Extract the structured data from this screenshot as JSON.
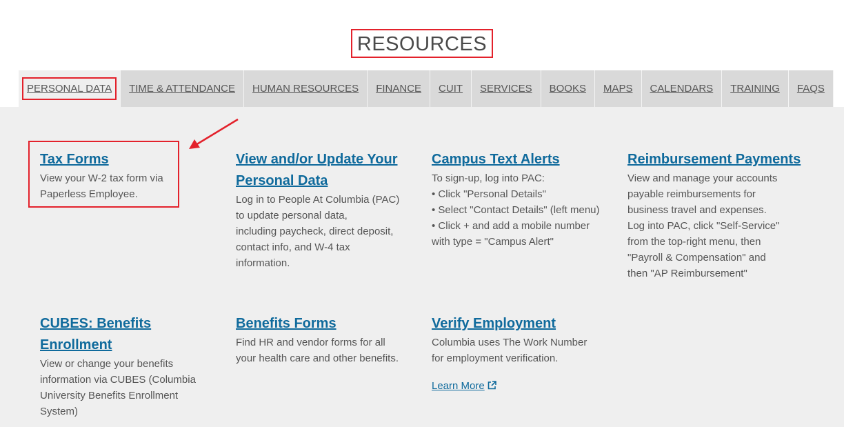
{
  "header": {
    "title": "RESOURCES"
  },
  "tabs": [
    {
      "label": "PERSONAL DATA",
      "active": true
    },
    {
      "label": "TIME & ATTENDANCE"
    },
    {
      "label": "HUMAN RESOURCES"
    },
    {
      "label": "FINANCE"
    },
    {
      "label": "CUIT"
    },
    {
      "label": "SERVICES"
    },
    {
      "label": "BOOKS"
    },
    {
      "label": "MAPS"
    },
    {
      "label": "CALENDARS"
    },
    {
      "label": "TRAINING"
    },
    {
      "label": "FAQS"
    }
  ],
  "cards": [
    {
      "title": "Tax Forms",
      "lines": [
        "View your W-2 tax form via",
        "Paperless Employee."
      ]
    },
    {
      "title": "View and/or Update Your Personal Data",
      "lines": [
        "Log in to People At Columbia (PAC)",
        "to update personal data,",
        "including paycheck, direct deposit,",
        "contact info, and W-4 tax",
        "information."
      ]
    },
    {
      "title": "Campus Text Alerts",
      "lines": [
        "To sign-up, log into PAC:",
        "• Click \"Personal Details\"",
        "• Select \"Contact Details\" (left menu)",
        "• Click +  and add a mobile number",
        "with type = \"Campus Alert\""
      ]
    },
    {
      "title": "Reimbursement Payments",
      "lines": [
        "View and manage your accounts",
        "payable reimbursements for",
        "business travel and expenses.",
        "Log into PAC, click \"Self-Service\"",
        "from the top-right menu, then",
        "\"Payroll & Compensation\" and",
        "then \"AP Reimbursement\""
      ]
    },
    {
      "title": "CUBES: Benefits Enrollment",
      "lines": [
        "View or change your benefits",
        "information via CUBES (Columbia",
        "University Benefits Enrollment",
        "System)"
      ]
    },
    {
      "title": "Benefits Forms",
      "lines": [
        "Find HR and vendor forms for all",
        "your health care and other benefits."
      ]
    },
    {
      "title": "Verify Employment",
      "lines": [
        "Columbia uses The Work Number",
        "for employment verification."
      ],
      "link": "Learn More"
    }
  ],
  "colors": {
    "link": "#0f6a9c",
    "highlight": "#e3212b",
    "panel": "#efefef",
    "tab": "#d9d9d9"
  }
}
